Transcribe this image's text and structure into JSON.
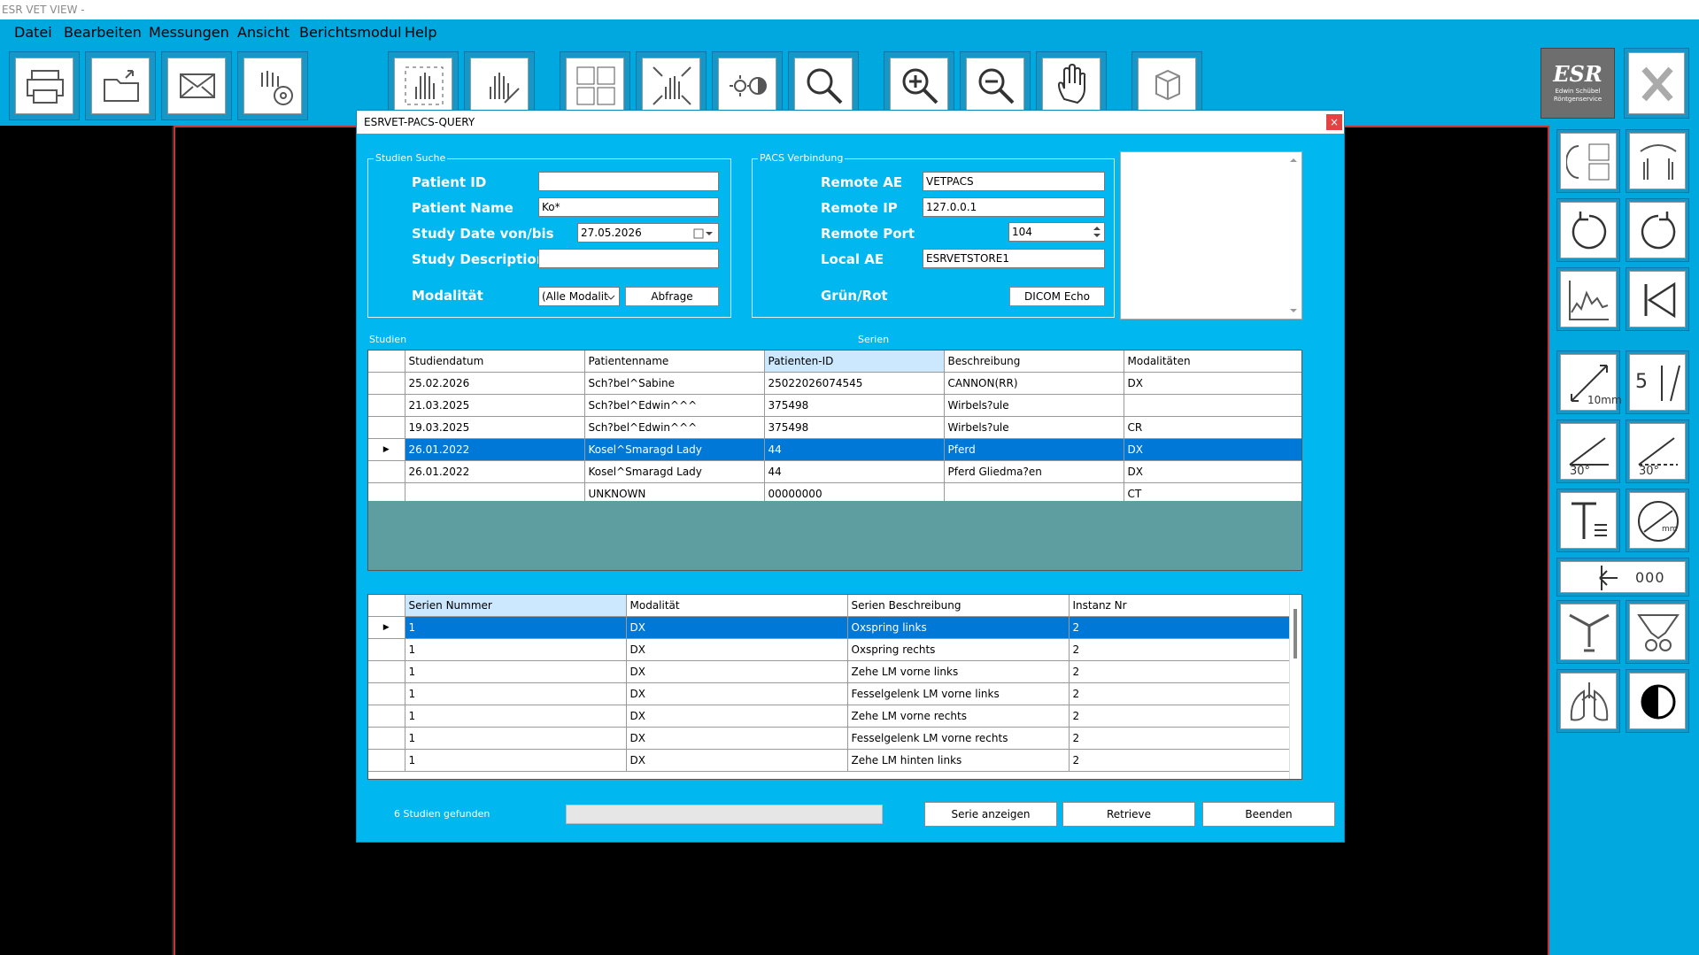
{
  "app": {
    "title": "ESR VET VIEW -"
  },
  "menu": [
    "Datei",
    "Bearbeiten",
    "Messungen",
    "Ansicht",
    "Berichtsmodul",
    "Help"
  ],
  "brand": {
    "logo_text": "ESR",
    "logo_sub1": "Edwin Schübel",
    "logo_sub2": "Röntgenservice"
  },
  "dialog": {
    "title": "ESRVET-PACS-QUERY",
    "close": "×",
    "search": {
      "legend": "Studien Suche",
      "patient_id_label": "Patient ID",
      "patient_id_value": "",
      "patient_name_label": "Patient Name",
      "patient_name_value": "Ko*",
      "study_date_label": "Study Date von/bis",
      "study_date_value": "27.05.2026",
      "study_desc_label": "Study Description",
      "study_desc_value": "",
      "modality_label": "Modalität",
      "modality_value": "(Alle Modalit",
      "query_button": "Abfrage"
    },
    "pacs": {
      "legend": "PACS Verbindung",
      "remote_ae_label": "Remote AE",
      "remote_ae_value": "VETPACS",
      "remote_ip_label": "Remote IP",
      "remote_ip_value": "127.0.0.1",
      "remote_port_label": "Remote Port",
      "remote_port_value": "104",
      "local_ae_label": "Local AE",
      "local_ae_value": "ESRVETSTORE1",
      "status_label": "Grün/Rot",
      "echo_button": "DICOM Echo"
    },
    "studies_label": "Studien",
    "series_label": "Serien",
    "studies": {
      "columns": [
        "Studiendatum",
        "Patientenname",
        "Patienten-ID",
        "Beschreibung",
        "Modalitäten"
      ],
      "rows": [
        [
          "25.02.2026",
          "Sch?bel^Sabine",
          "25022026074545",
          "CANNON(RR)",
          "DX"
        ],
        [
          "21.03.2025",
          "Sch?bel^Edwin^^^",
          "375498",
          "Wirbels?ule",
          ""
        ],
        [
          "19.03.2025",
          "Sch?bel^Edwin^^^",
          "375498",
          "Wirbels?ule",
          "CR"
        ],
        [
          "26.01.2022",
          "Kosel^Smaragd Lady",
          "44",
          "Pferd",
          "DX"
        ],
        [
          "26.01.2022",
          "Kosel^Smaragd Lady",
          "44",
          "Pferd Gliedma?en",
          "DX"
        ],
        [
          "",
          "UNKNOWN",
          "00000000",
          "",
          "CT"
        ]
      ],
      "selected_row": 3
    },
    "series": {
      "columns": [
        "Serien Nummer",
        "Modalität",
        "Serien Beschreibung",
        "Instanz Nr"
      ],
      "rows": [
        [
          "1",
          "DX",
          "Oxspring links",
          "2"
        ],
        [
          "1",
          "DX",
          "Oxspring rechts",
          "2"
        ],
        [
          "1",
          "DX",
          "Zehe LM vorne links",
          "2"
        ],
        [
          "1",
          "DX",
          "Fesselgelenk LM vorne links",
          "2"
        ],
        [
          "1",
          "DX",
          "Zehe LM vorne rechts",
          "2"
        ],
        [
          "1",
          "DX",
          "Fesselgelenk LM vorne rechts",
          "2"
        ],
        [
          "1",
          "DX",
          "Zehe LM hinten links",
          "2"
        ]
      ],
      "selected_row": 0
    },
    "status_text": "6 Studien gefunden",
    "buttons": {
      "show_series": "Serie anzeigen",
      "retrieve": "Retrieve",
      "close": "Beenden"
    }
  },
  "side_labels": {
    "measure_mm": "10mm",
    "angle1": "30°",
    "angle2": "30°",
    "five": "5",
    "circle_mm": "mm",
    "ruler": "000"
  },
  "colors": {
    "accent": "#00a8e0",
    "dialog_bg": "#00b7f0",
    "selection": "#0078d7",
    "viewer_border": "#c83232"
  }
}
